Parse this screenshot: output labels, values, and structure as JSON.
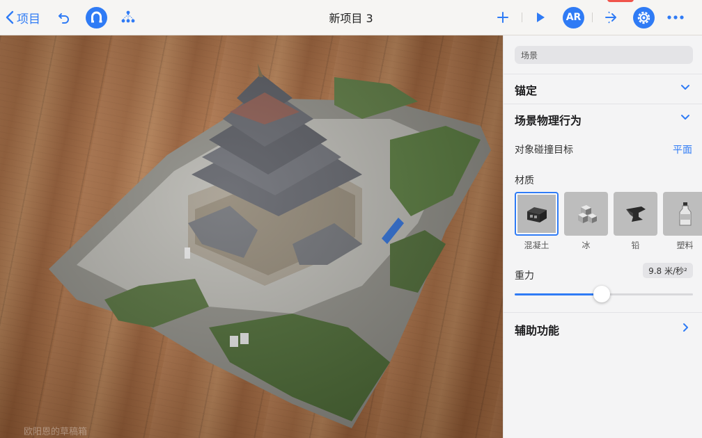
{
  "toolbar": {
    "back_label": "项目",
    "title": "新项目 3",
    "ar_label": "AR"
  },
  "viewport": {
    "watermark": "欧阳恩的草稿箱"
  },
  "panel": {
    "search_text": "场景",
    "anchor_title": "锚定",
    "physics_title": "场景物理行为",
    "collision_label": "对象碰撞目标",
    "collision_value": "平面",
    "material_label": "材质",
    "materials": [
      {
        "name": "混凝土",
        "icon": "concrete-block-icon",
        "selected": true
      },
      {
        "name": "冰",
        "icon": "ice-cubes-icon",
        "selected": false
      },
      {
        "name": "铅",
        "icon": "lead-anvil-icon",
        "selected": false
      },
      {
        "name": "塑料",
        "icon": "plastic-bottle-icon",
        "selected": false
      }
    ],
    "gravity_label": "重力",
    "gravity_value": "9.8 米/秒²",
    "gravity_slider_fraction": 0.49,
    "accessibility_title": "辅助功能"
  },
  "colors": {
    "accent": "#2f7bf5",
    "badge": "#f0544b"
  }
}
